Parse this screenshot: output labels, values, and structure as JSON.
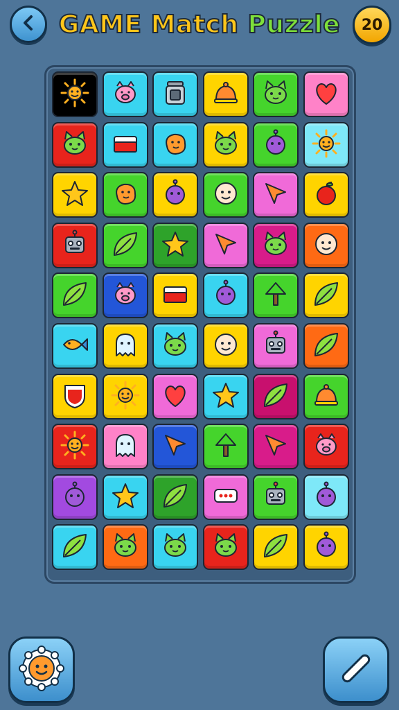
{
  "header": {
    "title_word1": "GAME",
    "title_word2": "Match",
    "title_word3": "Puzzle",
    "score": "20",
    "back_icon": "chevron-left-icon"
  },
  "board": {
    "columns": 6,
    "rows": 10,
    "tiles": [
      {
        "icon": "sun",
        "bg": "#000000"
      },
      {
        "icon": "pig",
        "bg": "#39d4f0"
      },
      {
        "icon": "jar",
        "bg": "#39d4f0"
      },
      {
        "icon": "bell",
        "bg": "#ffd400"
      },
      {
        "icon": "cat",
        "bg": "#45d42c"
      },
      {
        "icon": "heart",
        "bg": "#ff82c8"
      },
      {
        "icon": "cat",
        "bg": "#e8241c"
      },
      {
        "icon": "box",
        "bg": "#39d4f0"
      },
      {
        "icon": "blob",
        "bg": "#39d4f0"
      },
      {
        "icon": "cat",
        "bg": "#ffd400"
      },
      {
        "icon": "orb",
        "bg": "#45d42c"
      },
      {
        "icon": "sun",
        "bg": "#7ee8f8"
      },
      {
        "icon": "star",
        "bg": "#ffd400"
      },
      {
        "icon": "blob",
        "bg": "#45d42c"
      },
      {
        "icon": "orb",
        "bg": "#ffd400"
      },
      {
        "icon": "face",
        "bg": "#45d42c"
      },
      {
        "icon": "arrow",
        "bg": "#f06ad8"
      },
      {
        "icon": "apple",
        "bg": "#ffd400"
      },
      {
        "icon": "robot",
        "bg": "#e8241c"
      },
      {
        "icon": "leaf",
        "bg": "#45d42c"
      },
      {
        "icon": "star",
        "bg": "#2ea32a"
      },
      {
        "icon": "arrow",
        "bg": "#f06ad8"
      },
      {
        "icon": "cat",
        "bg": "#d81c8a"
      },
      {
        "icon": "face",
        "bg": "#ff6a14"
      },
      {
        "icon": "leaf",
        "bg": "#45d42c"
      },
      {
        "icon": "pig",
        "bg": "#2356d8"
      },
      {
        "icon": "box",
        "bg": "#ffd400"
      },
      {
        "icon": "orb",
        "bg": "#39d4f0"
      },
      {
        "icon": "tree",
        "bg": "#45d42c"
      },
      {
        "icon": "leaf",
        "bg": "#ffd400"
      },
      {
        "icon": "fish",
        "bg": "#39d4f0"
      },
      {
        "icon": "ghost",
        "bg": "#ffd400"
      },
      {
        "icon": "cat",
        "bg": "#39d4f0"
      },
      {
        "icon": "face",
        "bg": "#ffd400"
      },
      {
        "icon": "robot",
        "bg": "#f06ad8"
      },
      {
        "icon": "leaf",
        "bg": "#ff6a14"
      },
      {
        "icon": "shield",
        "bg": "#ffd400"
      },
      {
        "icon": "sun",
        "bg": "#ffd400"
      },
      {
        "icon": "heart",
        "bg": "#f06ad8"
      },
      {
        "icon": "star",
        "bg": "#39d4f0"
      },
      {
        "icon": "leaf",
        "bg": "#c8106e"
      },
      {
        "icon": "bell",
        "bg": "#45d42c"
      },
      {
        "icon": "sun",
        "bg": "#e8241c"
      },
      {
        "icon": "ghost",
        "bg": "#ff82c8"
      },
      {
        "icon": "arrow",
        "bg": "#2356d8"
      },
      {
        "icon": "tree",
        "bg": "#45d42c"
      },
      {
        "icon": "arrow",
        "bg": "#d81c8a"
      },
      {
        "icon": "pig",
        "bg": "#e8241c"
      },
      {
        "icon": "orb",
        "bg": "#a24ae0"
      },
      {
        "icon": "star",
        "bg": "#39d4f0"
      },
      {
        "icon": "leaf",
        "bg": "#2ea32a"
      },
      {
        "icon": "dots",
        "bg": "#f06ad8"
      },
      {
        "icon": "robot",
        "bg": "#45d42c"
      },
      {
        "icon": "orb",
        "bg": "#7ee8f8"
      },
      {
        "icon": "leaf",
        "bg": "#39d4f0"
      },
      {
        "icon": "cat",
        "bg": "#ff6a14"
      },
      {
        "icon": "cat",
        "bg": "#39d4f0"
      },
      {
        "icon": "cat",
        "bg": "#e8241c"
      },
      {
        "icon": "leaf",
        "bg": "#ffd400"
      },
      {
        "icon": "orb",
        "bg": "#ffd400"
      }
    ]
  },
  "footer": {
    "left_icon": "sun-face-icon",
    "right_icon": "wand-icon"
  }
}
